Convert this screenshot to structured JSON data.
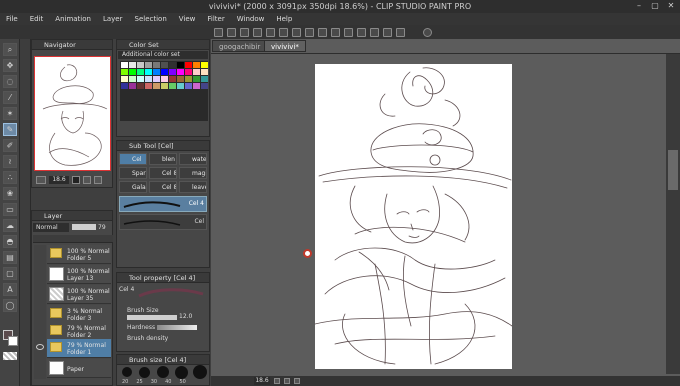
{
  "window": {
    "title": "vivivivi* (2000 x 3091px 350dpi 18.6%) - CLIP STUDIO PAINT PRO",
    "minimize": "–",
    "maximize": "▢",
    "close": "✕"
  },
  "menu": [
    "File",
    "Edit",
    "Animation",
    "Layer",
    "Selection",
    "View",
    "Filter",
    "Window",
    "Help"
  ],
  "tabs": [
    "googachibir",
    "vivivivi*"
  ],
  "navigator": {
    "title": "Navigator",
    "zoom": "18.6"
  },
  "color_set": {
    "title": "Color Set",
    "set_name": "Additional color set",
    "colors": [
      "#ffffff",
      "#e8e8e8",
      "#c8c8c8",
      "#a0a0a0",
      "#787878",
      "#505050",
      "#303030",
      "#000000",
      "#ff0000",
      "#ff7f00",
      "#ffff00",
      "#7fff00",
      "#00ff00",
      "#00ff7f",
      "#00ffff",
      "#007fff",
      "#0000ff",
      "#7f00ff",
      "#ff00ff",
      "#ff007f",
      "#ffcccc",
      "#ffe0c0",
      "#ffffcc",
      "#ccffcc",
      "#ccffff",
      "#cce0ff",
      "#e0ccff",
      "#ffcce8",
      "#993333",
      "#996633",
      "#999933",
      "#339933",
      "#339999",
      "#333399",
      "#993399",
      "#663333",
      "#cc6666",
      "#cc9966",
      "#cccc66",
      "#66cc66",
      "#66cccc",
      "#6666cc",
      "#cc66cc",
      "#444488"
    ]
  },
  "sub_tool": {
    "title": "Sub Tool [Cel]",
    "items": [
      "Cel",
      "blen",
      "water",
      "Spar",
      "Cel 8",
      "magic",
      "Galax",
      "Cel 8",
      "leaves"
    ],
    "presets": [
      "Cel 4",
      "Cel"
    ]
  },
  "tool_property": {
    "title": "Tool property [Cel 4]",
    "preset": "Cel 4",
    "brush_size_label": "Brush Size",
    "brush_size_value": "12.0",
    "hardness_label": "Hardness",
    "density_label": "Brush density"
  },
  "brush_size": {
    "title": "Brush size [Cel 4]",
    "sizes": [
      "20",
      "25",
      "30",
      "40",
      "50"
    ]
  },
  "layers": {
    "title": "Layer",
    "blend": "Normal",
    "opacity": "79",
    "rows": [
      {
        "l1": "100 %  Normal",
        "l2": "Folder 5",
        "type": "folder",
        "selected": false
      },
      {
        "l1": "100 %  Normal",
        "l2": "Layer 13",
        "type": "layer",
        "selected": false
      },
      {
        "l1": "100 %  Normal",
        "l2": "Layer 35",
        "type": "layer",
        "selected": false
      },
      {
        "l1": "3 %  Normal",
        "l2": "Folder 3",
        "type": "folder",
        "selected": false
      },
      {
        "l1": "79 %  Normal",
        "l2": "Folder 2",
        "type": "folder",
        "selected": false
      },
      {
        "l1": "79 %  Normal",
        "l2": "Folder 1",
        "type": "folder",
        "selected": true
      },
      {
        "l1": "",
        "l2": "Paper",
        "type": "paper",
        "selected": false
      }
    ]
  },
  "status": {
    "zoom": "18.6"
  },
  "colors": {
    "accent": "#4f7ea6",
    "sketch": "#5a4a4c"
  }
}
